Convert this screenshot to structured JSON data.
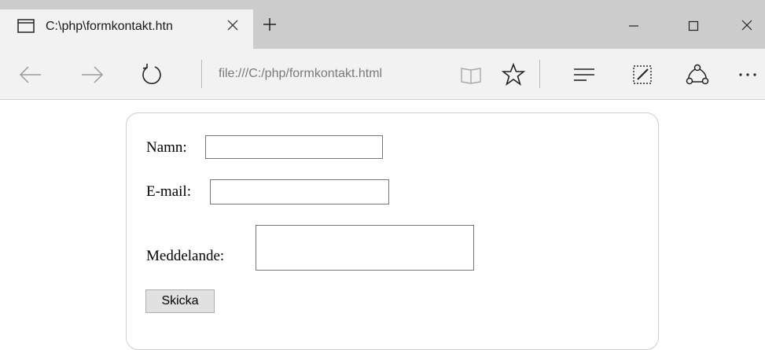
{
  "browser": {
    "tab": {
      "title": "C:\\php\\formkontakt.htn",
      "icon": "tab-page-icon"
    },
    "new_tab_icon": "plus-icon",
    "window_controls": [
      "minimize-icon",
      "maximize-icon",
      "close-icon"
    ],
    "address": {
      "url": "file:///C:/php/formkontakt.html"
    },
    "toolbar_icons": [
      "back-arrow-icon",
      "forward-arrow-icon",
      "refresh-icon",
      "reading-view-icon",
      "favorite-star-icon",
      "hub-icon",
      "web-note-icon",
      "share-icon",
      "more-icon"
    ]
  },
  "form": {
    "name_label": "Namn:",
    "name_value": "",
    "email_label": "E-mail:",
    "email_value": "",
    "message_label": "Meddelande:",
    "message_value": "",
    "submit_label": "Skicka"
  },
  "colors": {
    "titlebar": "#cccccc",
    "tab_active": "#f2f2f2",
    "addressbar": "#f2f2f2",
    "page": "#ffffff",
    "form_border": "#cfcfcf"
  }
}
